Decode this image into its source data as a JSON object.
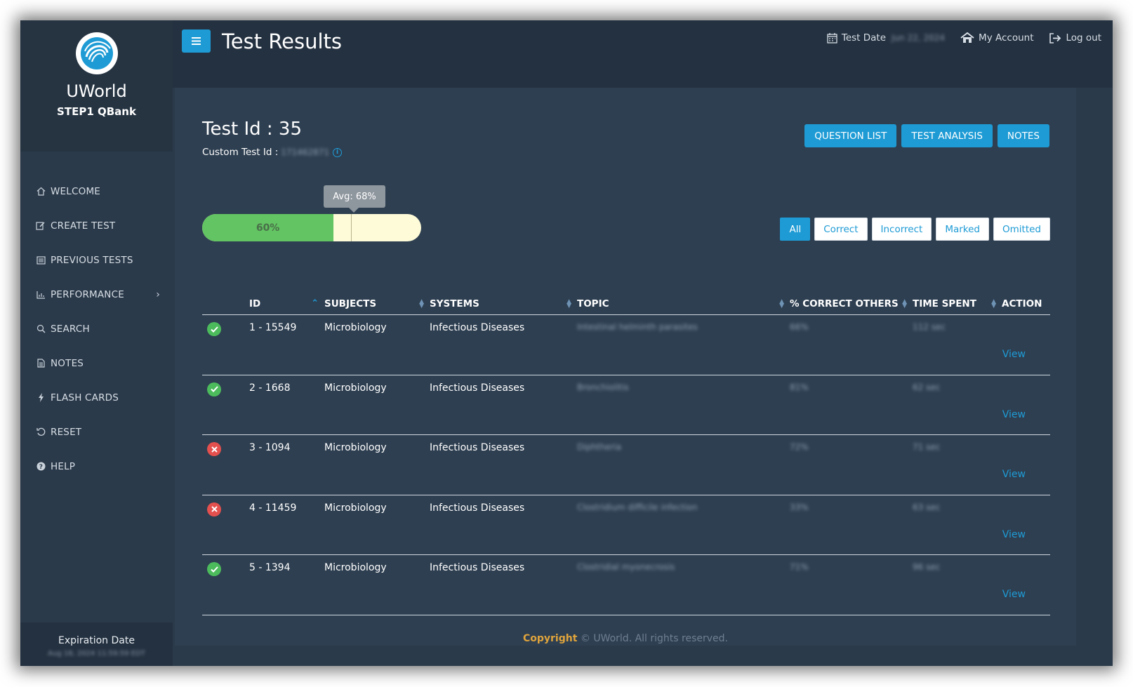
{
  "brand": {
    "name": "UWorld",
    "subtitle": "STEP1 QBank"
  },
  "sidebar": {
    "items": [
      {
        "label": "WELCOME",
        "icon": "home-icon"
      },
      {
        "label": "CREATE TEST",
        "icon": "edit-icon"
      },
      {
        "label": "PREVIOUS TESTS",
        "icon": "list-icon"
      },
      {
        "label": "PERFORMANCE",
        "icon": "bar-chart-icon"
      },
      {
        "label": "SEARCH",
        "icon": "search-icon"
      },
      {
        "label": "NOTES",
        "icon": "document-icon"
      },
      {
        "label": "FLASH CARDS",
        "icon": "bolt-icon"
      },
      {
        "label": "RESET",
        "icon": "reset-icon"
      },
      {
        "label": "HELP",
        "icon": "help-icon"
      }
    ],
    "expiration_label": "Expiration Date",
    "expiration_value": "Aug 18, 2024 11:59:59 EDT"
  },
  "header": {
    "title": "Test Results",
    "test_date_label": "Test Date",
    "test_date_value": "Jun 22, 2024",
    "account_label": "My Account",
    "logout_label": "Log out"
  },
  "test": {
    "id_label": "Test Id : 35",
    "custom_id_label": "Custom Test Id :",
    "custom_id_value": "171462871",
    "score_label": "60%",
    "score": 0.6,
    "avg_label": "Avg: 68%",
    "avg": 0.68
  },
  "actions": {
    "question_list": "QUESTION LIST",
    "test_analysis": "TEST ANALYSIS",
    "notes": "NOTES"
  },
  "filters": [
    "All",
    "Correct",
    "Incorrect",
    "Marked",
    "Omitted"
  ],
  "table": {
    "headers": [
      "ID",
      "SUBJECTS",
      "SYSTEMS",
      "TOPIC",
      "% CORRECT OTHERS",
      "TIME SPENT",
      "ACTION"
    ],
    "rows": [
      {
        "status": "correct",
        "id": "1 - 15549",
        "subject": "Microbiology",
        "system": "Infectious Diseases",
        "topic": "Intestinal helminth parasites",
        "pct": "66%",
        "time": "112 sec",
        "action": "View"
      },
      {
        "status": "correct",
        "id": "2 - 1668",
        "subject": "Microbiology",
        "system": "Infectious Diseases",
        "topic": "Bronchiolitis",
        "pct": "81%",
        "time": "62 sec",
        "action": "View"
      },
      {
        "status": "incorrect",
        "id": "3 - 1094",
        "subject": "Microbiology",
        "system": "Infectious Diseases",
        "topic": "Diphtheria",
        "pct": "72%",
        "time": "71 sec",
        "action": "View"
      },
      {
        "status": "incorrect",
        "id": "4 - 11459",
        "subject": "Microbiology",
        "system": "Infectious Diseases",
        "topic": "Clostridium difficile infection",
        "pct": "33%",
        "time": "63 sec",
        "action": "View"
      },
      {
        "status": "correct",
        "id": "5 - 1394",
        "subject": "Microbiology",
        "system": "Infectious Diseases",
        "topic": "Clostridial myonecrosis",
        "pct": "71%",
        "time": "96 sec",
        "action": "View"
      }
    ]
  },
  "footer": {
    "copyright": "Copyright",
    "text": "© UWorld. All rights reserved."
  },
  "colors": {
    "accent": "#1e9bd5",
    "correct": "#4cbb5c",
    "incorrect": "#e3504e",
    "progress_fill": "#62c462"
  }
}
